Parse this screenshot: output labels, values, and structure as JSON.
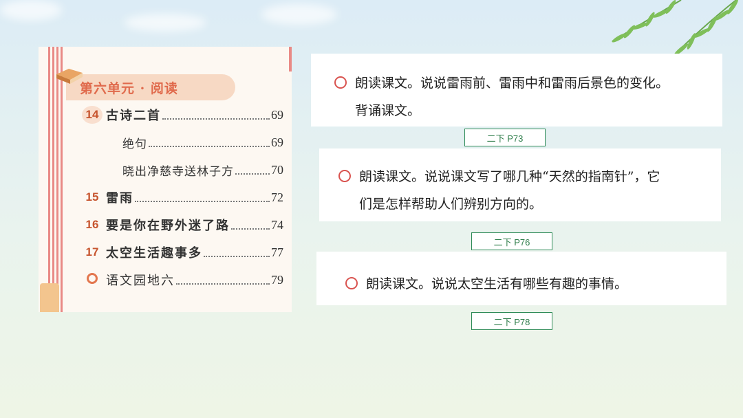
{
  "toc": {
    "header": "第六单元 · 阅读",
    "rows": [
      {
        "num": "14",
        "title": "古诗二首",
        "page": "69"
      },
      {
        "num": "",
        "title": "绝句",
        "page": "69"
      },
      {
        "num": "",
        "title": "晓出净慈寺送林子方",
        "page": "70"
      },
      {
        "num": "15",
        "title": "雷雨",
        "page": "72"
      },
      {
        "num": "16",
        "title": "要是你在野外迷了路",
        "page": "74"
      },
      {
        "num": "17",
        "title": "太空生活趣事多",
        "page": "77"
      },
      {
        "num": "",
        "title": "语文园地六",
        "page": "79"
      }
    ]
  },
  "panels": [
    {
      "line1": "朗读课文。说说雷雨前、雷雨中和雷雨后景色的变化。",
      "line2": "背诵课文。",
      "ref": "二下  P73"
    },
    {
      "line1": "朗读课文。说说课文写了哪几种“天然的指南针”，它",
      "line2": "们是怎样帮助人们辨别方向的。",
      "ref": "二下  P76"
    },
    {
      "line1": "朗读课文。说说太空生活有哪些有趣的事情。",
      "ref": "二下  P78"
    }
  ]
}
